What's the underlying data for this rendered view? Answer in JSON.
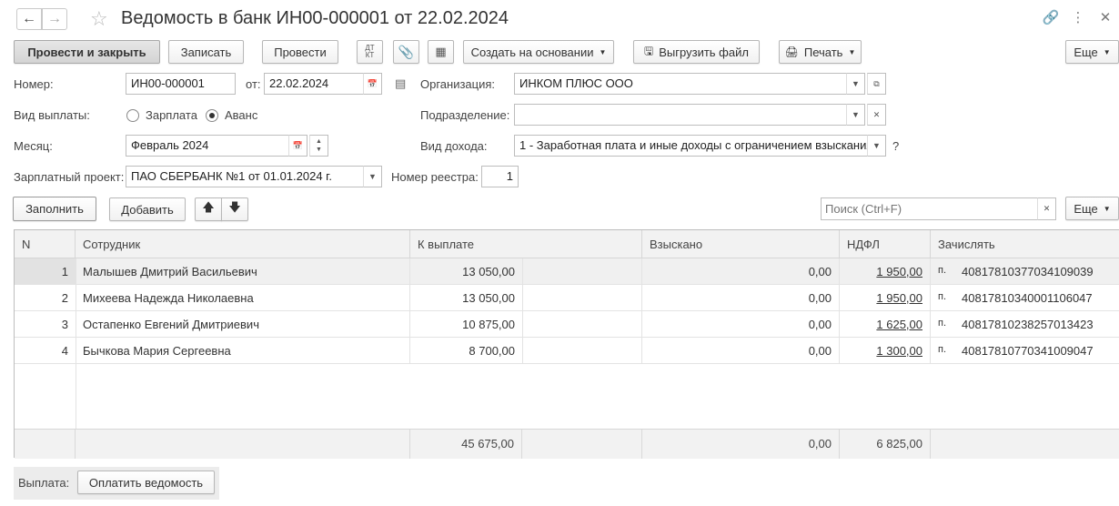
{
  "window": {
    "title": "Ведомость в банк ИН00-000001 от 22.02.2024"
  },
  "toolbar": {
    "post_close": "Провести и закрыть",
    "save": "Записать",
    "post": "Провести",
    "dt_kt": "ДТ КТ",
    "create_based": "Создать на основании",
    "export_file": "Выгрузить файл",
    "print": "Печать",
    "more": "Еще"
  },
  "form": {
    "number_label": "Номер:",
    "number": "ИН00-000001",
    "date_label": "от:",
    "date": "22.02.2024",
    "org_label": "Организация:",
    "org": "ИНКОМ ПЛЮС ООО",
    "payment_type_label": "Вид выплаты:",
    "payment_option_salary": "Зарплата",
    "payment_option_advance": "Аванс",
    "payment_selected": "advance",
    "division_label": "Подразделение:",
    "division": "",
    "month_label": "Месяц:",
    "month": "Февраль 2024",
    "income_type_label": "Вид дохода:",
    "income_type": "1 - Заработная плата и иные доходы с ограничением взыскания",
    "help": "?",
    "salary_project_label": "Зарплатный проект:",
    "salary_project": "ПАО СБЕРБАНК №1 от 01.01.2024 г.",
    "registry_label": "Номер реестра:",
    "registry": "1"
  },
  "table_toolbar": {
    "fill": "Заполнить",
    "add": "Добавить",
    "search_placeholder": "Поиск (Ctrl+F)",
    "more": "Еще"
  },
  "table": {
    "headers": {
      "n": "N",
      "employee": "Сотрудник",
      "to_pay": "К выплате",
      "collected": "Взыскано",
      "ndfl": "НДФЛ",
      "credit": "Зачислять"
    },
    "rows": [
      {
        "n": "1",
        "employee": "Малышев Дмитрий Васильевич",
        "to_pay": "13 050,00",
        "collected": "0,00",
        "ndfl": "1 950,00",
        "credit_prefix": "п.",
        "account": "40817810377034109039"
      },
      {
        "n": "2",
        "employee": "Михеева Надежда Николаевна",
        "to_pay": "13 050,00",
        "collected": "0,00",
        "ndfl": "1 950,00",
        "credit_prefix": "п.",
        "account": "40817810340001106047"
      },
      {
        "n": "3",
        "employee": "Остапенко Евгений Дмитриевич",
        "to_pay": "10 875,00",
        "collected": "0,00",
        "ndfl": "1 625,00",
        "credit_prefix": "п.",
        "account": "40817810238257013423"
      },
      {
        "n": "4",
        "employee": "Бычкова Мария Сергеевна",
        "to_pay": "8 700,00",
        "collected": "0,00",
        "ndfl": "1 300,00",
        "credit_prefix": "п.",
        "account": "40817810770341009047"
      }
    ],
    "totals": {
      "to_pay": "45 675,00",
      "collected": "0,00",
      "ndfl": "6 825,00"
    }
  },
  "payment": {
    "label": "Выплата:",
    "button": "Оплатить ведомость"
  }
}
